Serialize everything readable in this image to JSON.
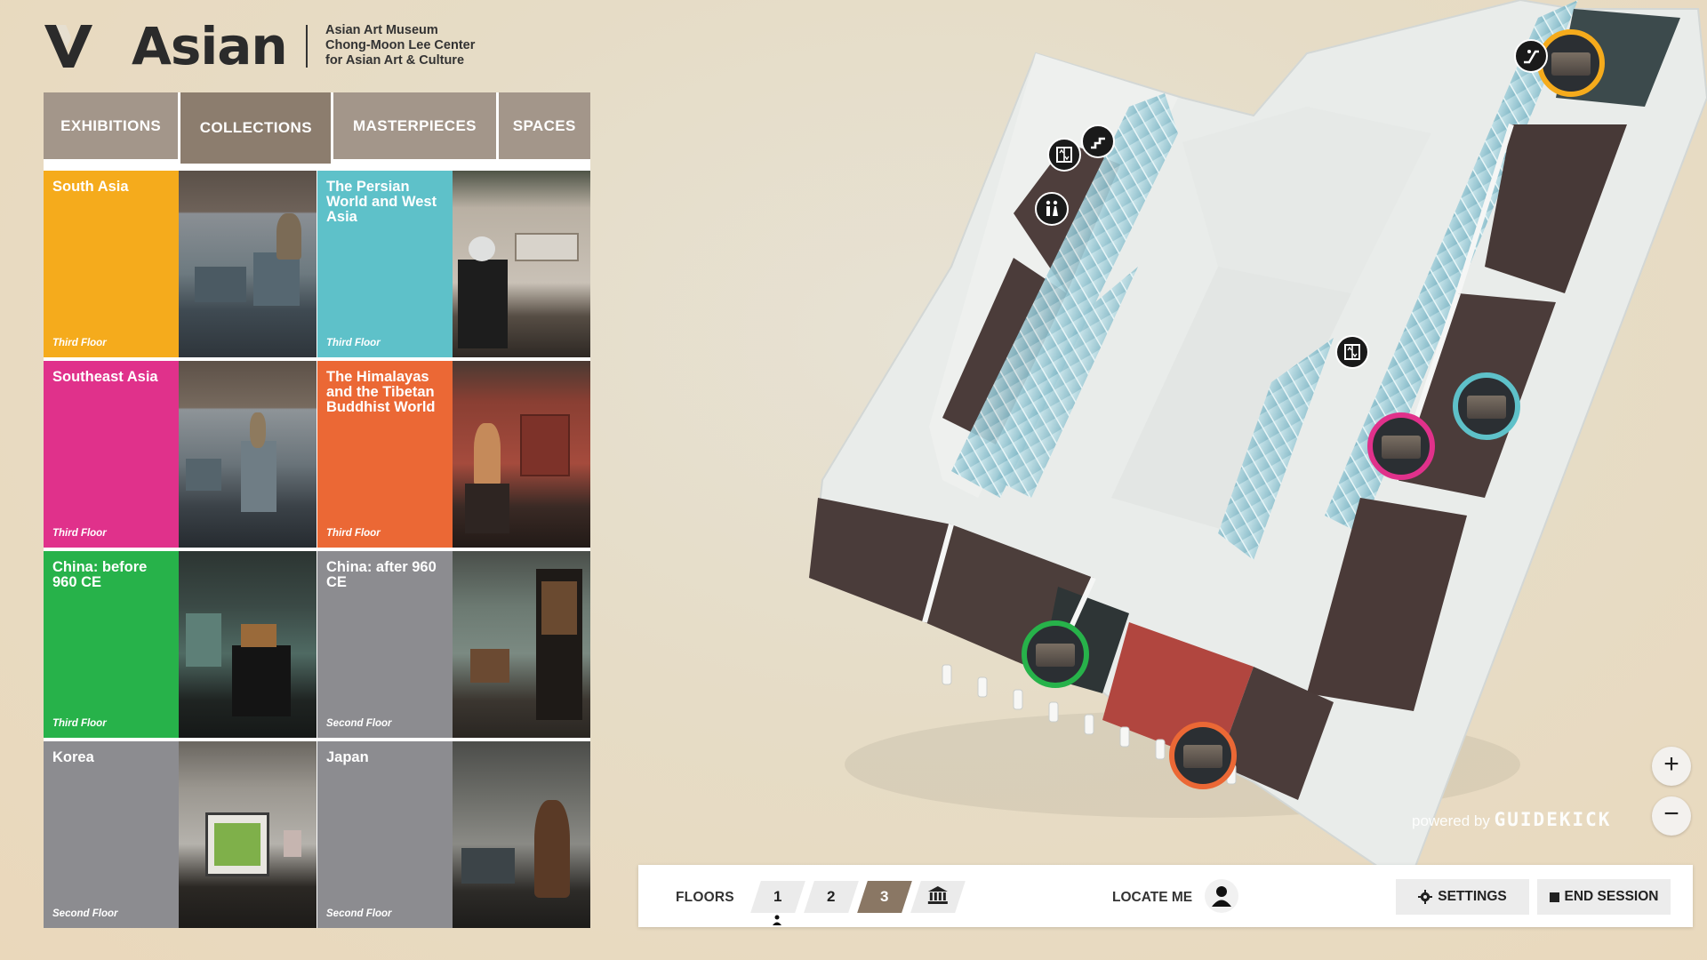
{
  "header": {
    "logo_word": "Asian",
    "org_lines": [
      "Asian Art Museum",
      "Chong-Moon Lee Center",
      "for Asian Art & Culture"
    ],
    "logo_icon": "museum-v-logo-icon"
  },
  "tabs": [
    {
      "label": "EXHIBITIONS",
      "active": false
    },
    {
      "label": "COLLECTIONS",
      "active": true
    },
    {
      "label": "MASTERPIECES",
      "active": false
    },
    {
      "label": "SPACES",
      "active": false
    }
  ],
  "collections": [
    {
      "title": "South Asia",
      "floor": "Third Floor",
      "color": "#f5ab1c"
    },
    {
      "title": "The Persian World and West Asia",
      "floor": "Third Floor",
      "color": "#5ec1c9"
    },
    {
      "title": "Southeast Asia",
      "floor": "Third Floor",
      "color": "#e0318b"
    },
    {
      "title": "The Himalayas and the Tibetan Buddhist World",
      "floor": "Third Floor",
      "color": "#eb6835"
    },
    {
      "title": "China: before 960 CE",
      "floor": "Third Floor",
      "color": "#27b24a"
    },
    {
      "title": "China: after 960 CE",
      "floor": "Second Floor",
      "color": "#8c8c90"
    },
    {
      "title": "Korea",
      "floor": "Second Floor",
      "color": "#8c8c90"
    },
    {
      "title": "Japan",
      "floor": "Second Floor",
      "color": "#8c8c90"
    }
  ],
  "map": {
    "gallery_markers": [
      {
        "name": "south-asia",
        "color": "#f5ab1c"
      },
      {
        "name": "persian-world",
        "color": "#5ec1c9"
      },
      {
        "name": "southeast-asia",
        "color": "#e0318b"
      },
      {
        "name": "himalayas",
        "color": "#eb6835"
      },
      {
        "name": "china-before-960",
        "color": "#27b24a"
      }
    ],
    "amenity_icons": [
      "escalator-icon",
      "stairs-icon",
      "elevator-icon",
      "restroom-icon",
      "elevator-icon"
    ],
    "powered_by": "powered by",
    "brand": "GUIDEKICK",
    "zoom_in": "+",
    "zoom_out": "−"
  },
  "bottom_bar": {
    "floors_label": "FLOORS",
    "floors": [
      {
        "label": "1",
        "active": false
      },
      {
        "label": "2",
        "active": false
      },
      {
        "label": "3",
        "active": true
      }
    ],
    "museum_icon": "museum-building-icon",
    "locate_label": "LOCATE ME",
    "settings_label": "SETTINGS",
    "end_session_label": "END SESSION"
  }
}
